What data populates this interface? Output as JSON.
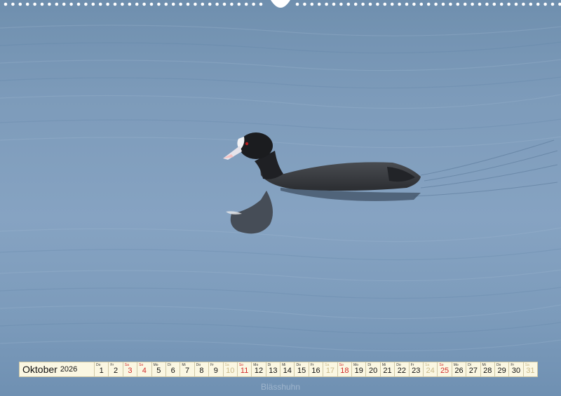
{
  "calendar": {
    "month": "Oktober",
    "year": "2026",
    "days": [
      {
        "dow": "Do",
        "num": "1",
        "type": "normal"
      },
      {
        "dow": "Fr",
        "num": "2",
        "type": "normal"
      },
      {
        "dow": "Sa",
        "num": "3",
        "type": "sat"
      },
      {
        "dow": "So",
        "num": "4",
        "type": "sun"
      },
      {
        "dow": "Mo",
        "num": "5",
        "type": "normal"
      },
      {
        "dow": "Di",
        "num": "6",
        "type": "normal"
      },
      {
        "dow": "Mi",
        "num": "7",
        "type": "normal"
      },
      {
        "dow": "Do",
        "num": "8",
        "type": "normal"
      },
      {
        "dow": "Fr",
        "num": "9",
        "type": "normal"
      },
      {
        "dow": "Sa",
        "num": "10",
        "type": "hol"
      },
      {
        "dow": "So",
        "num": "11",
        "type": "sun"
      },
      {
        "dow": "Mo",
        "num": "12",
        "type": "normal"
      },
      {
        "dow": "Di",
        "num": "13",
        "type": "normal"
      },
      {
        "dow": "Mi",
        "num": "14",
        "type": "normal"
      },
      {
        "dow": "Do",
        "num": "15",
        "type": "normal"
      },
      {
        "dow": "Fr",
        "num": "16",
        "type": "normal"
      },
      {
        "dow": "Sa",
        "num": "17",
        "type": "hol"
      },
      {
        "dow": "So",
        "num": "18",
        "type": "sun"
      },
      {
        "dow": "Mo",
        "num": "19",
        "type": "normal"
      },
      {
        "dow": "Di",
        "num": "20",
        "type": "normal"
      },
      {
        "dow": "Mi",
        "num": "21",
        "type": "normal"
      },
      {
        "dow": "Do",
        "num": "22",
        "type": "normal"
      },
      {
        "dow": "Fr",
        "num": "23",
        "type": "normal"
      },
      {
        "dow": "Sa",
        "num": "24",
        "type": "hol"
      },
      {
        "dow": "So",
        "num": "25",
        "type": "sun"
      },
      {
        "dow": "Mo",
        "num": "26",
        "type": "normal"
      },
      {
        "dow": "Di",
        "num": "27",
        "type": "normal"
      },
      {
        "dow": "Mi",
        "num": "28",
        "type": "normal"
      },
      {
        "dow": "Do",
        "num": "29",
        "type": "normal"
      },
      {
        "dow": "Fr",
        "num": "30",
        "type": "normal"
      },
      {
        "dow": "Sa",
        "num": "31",
        "type": "hol"
      }
    ]
  },
  "caption": "Blässhuhn",
  "colors": {
    "water": "#7d9bba",
    "calendar_bg": "#fbf7e2",
    "weekend": "#d12c2c"
  }
}
